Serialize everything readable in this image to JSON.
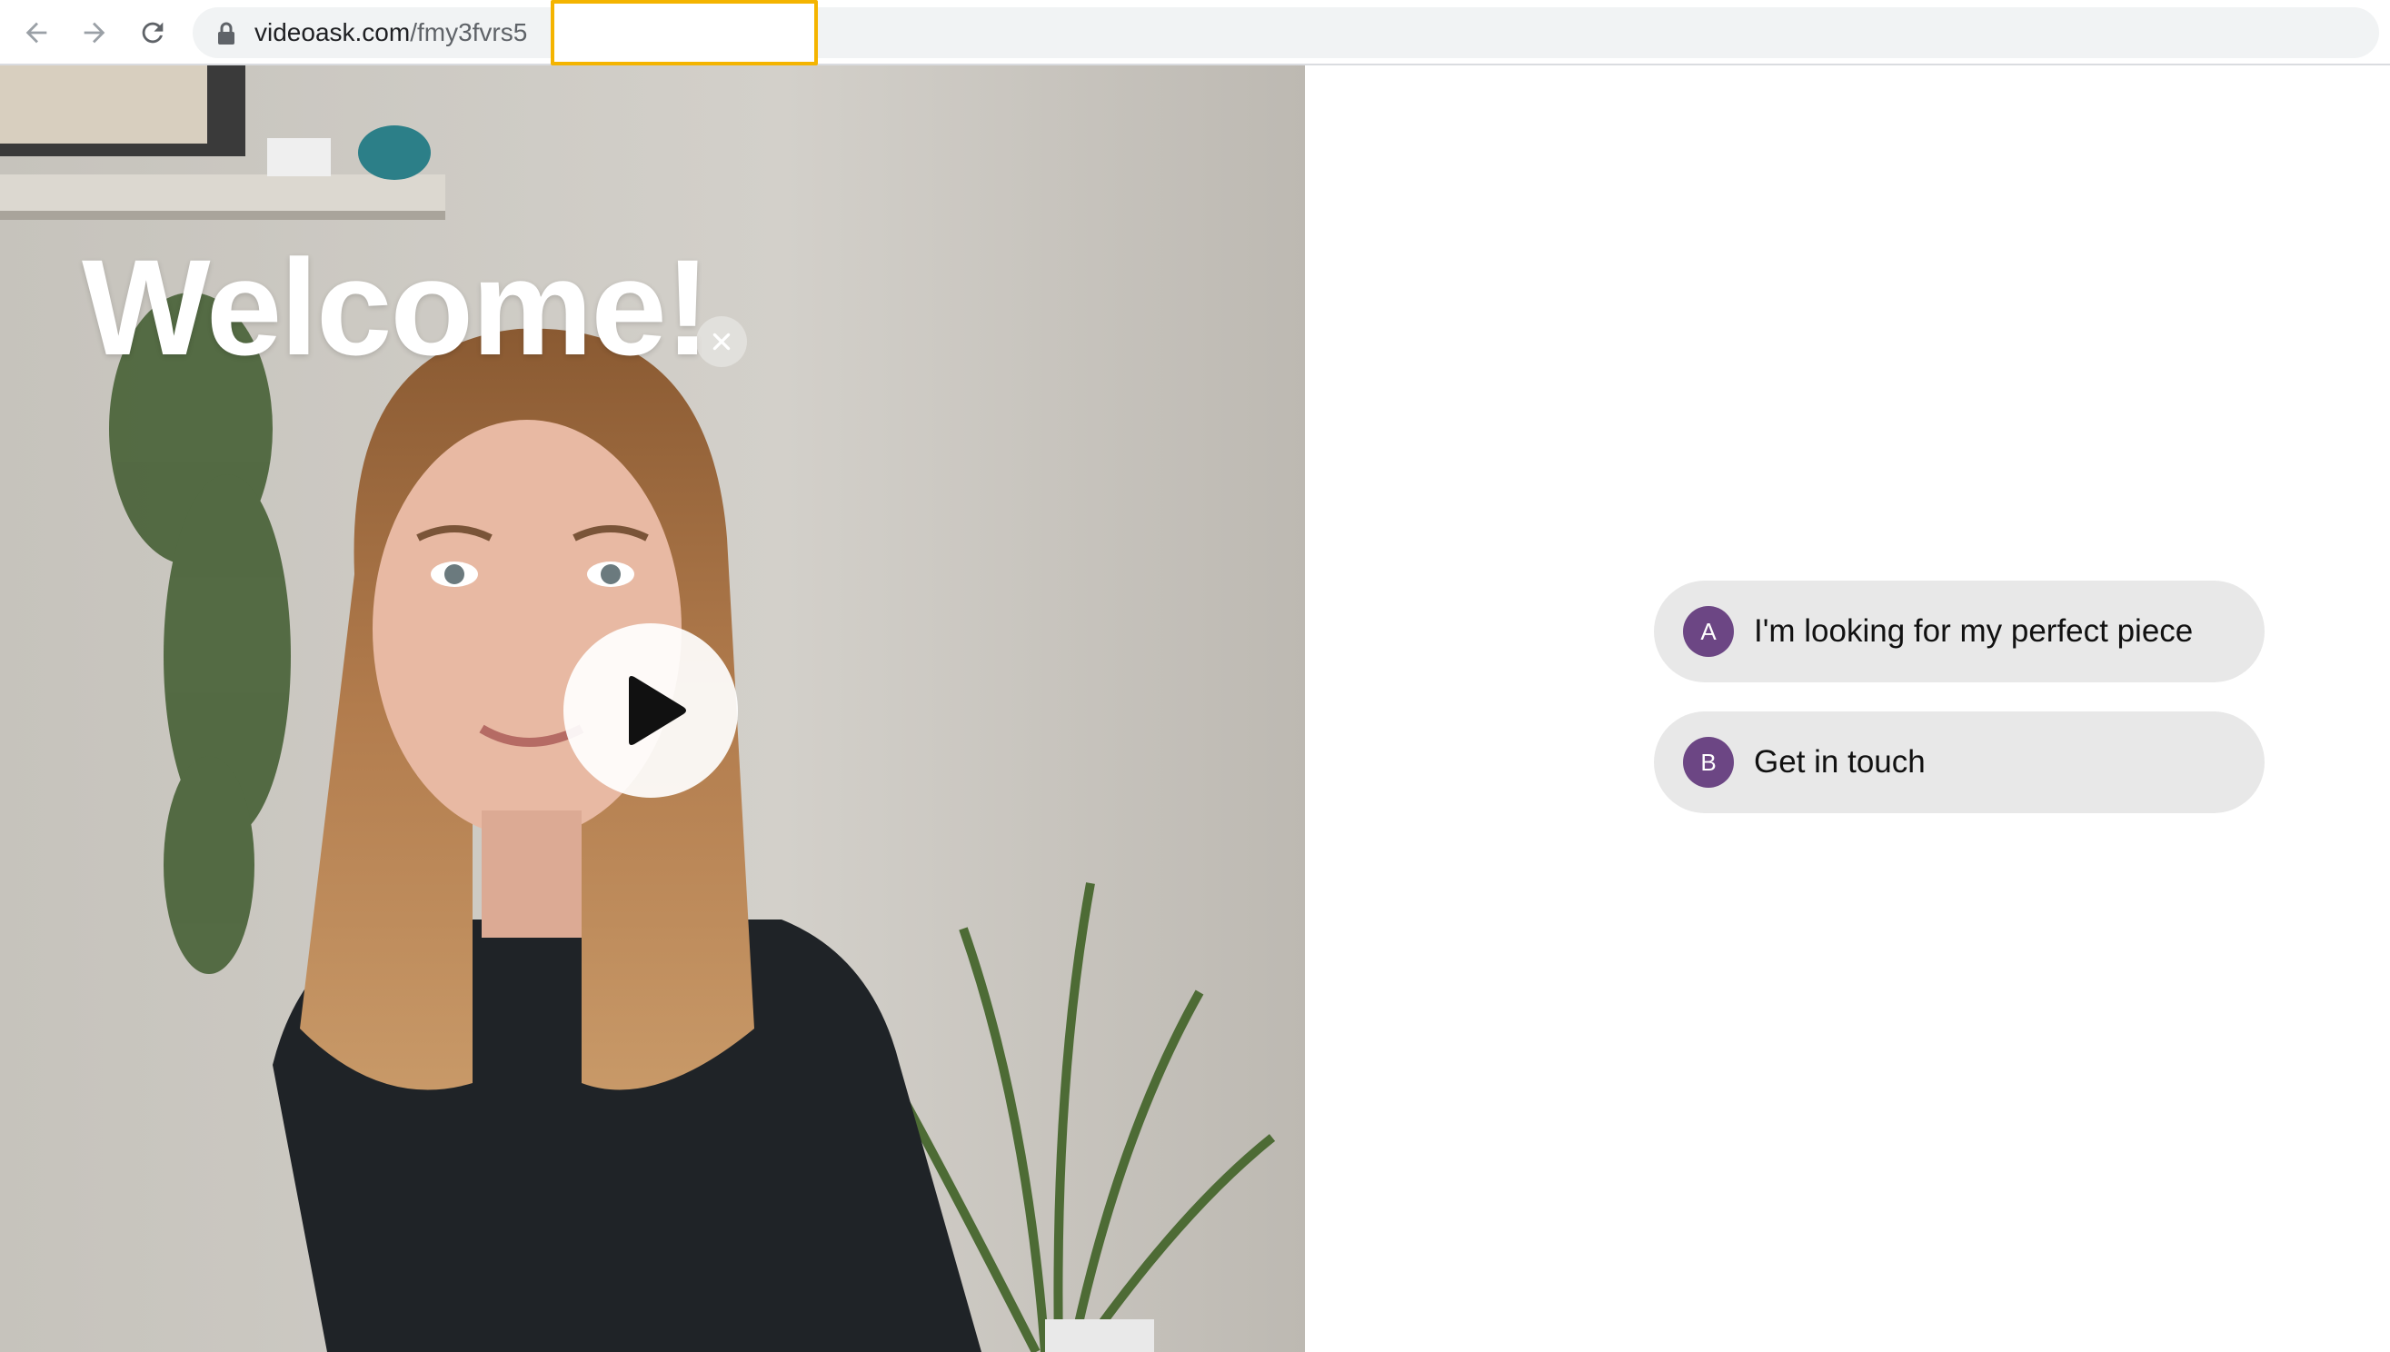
{
  "browser": {
    "url_host": "videoask.com",
    "url_path": "/fmy3fvrs5"
  },
  "video": {
    "title": "Welcome!"
  },
  "options": [
    {
      "letter": "A",
      "label": "I'm looking for my perfect piece"
    },
    {
      "letter": "B",
      "label": "Get in touch"
    }
  ],
  "colors": {
    "badge": "#6c4684",
    "option_bg": "#e8e8e8",
    "highlight": "#f4b400"
  }
}
